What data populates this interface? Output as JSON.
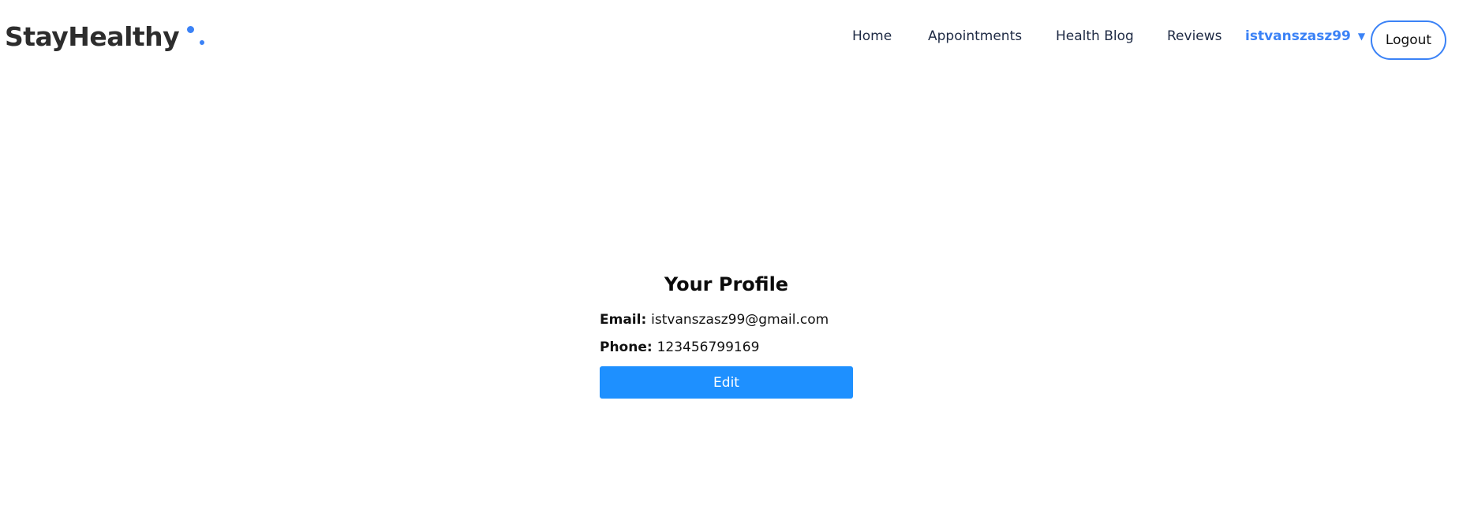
{
  "brand": {
    "name": "StayHealthy",
    "accent_color": "#3b82f6"
  },
  "nav": {
    "items": [
      {
        "label": "Home"
      },
      {
        "label": "Appointments"
      },
      {
        "label": "Health Blog"
      },
      {
        "label": "Reviews"
      }
    ],
    "user": {
      "name": "istvanszasz99",
      "caret_icon": "triangle-down"
    },
    "logout_label": "Logout"
  },
  "profile": {
    "title": "Your Profile",
    "email_label": "Email:",
    "email_value": "istvanszasz99@gmail.com",
    "phone_label": "Phone:",
    "phone_value": "123456799169",
    "edit_label": "Edit",
    "button_color": "#1e90ff"
  }
}
